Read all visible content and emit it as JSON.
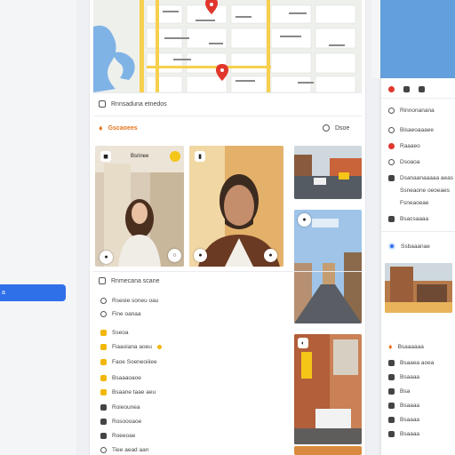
{
  "sidebar": {
    "active_label": "a"
  },
  "map": {
    "pins": [
      "red-pin",
      "red-pin"
    ],
    "colors": {
      "road": "#f6d04d",
      "water": "#7fb3e6",
      "land": "#eef0ec"
    }
  },
  "main": {
    "location_row": "Rnnsaduna etnedos",
    "section_title": "Gscaoees",
    "section_right": "Dsoe",
    "photos": {
      "woman_label": "Bsrinee",
      "man_label": "",
      "street_top_label": ""
    },
    "details_title": "Rnmecana scane",
    "details_items": [
      "Rseoie soneu oau",
      "Fine oanaa",
      "Sseoa",
      "Fiaaoiana aoeu",
      "Faoe Soeneoiiiee",
      "Bsaaaoaoe",
      "Bsaane taae aeu",
      "Roieounea",
      "Rosoooaoe",
      "Roeeoae",
      "Tiee aead aan"
    ]
  },
  "right_panel": {
    "top_icons": [
      "close-icon",
      "save-icon",
      "share-icon"
    ],
    "items": [
      "Rinnonanana",
      "Bisaeoaaaee",
      "Raaaeo",
      "Dsoaoa",
      "Dsanaanaaaaa aeas",
      "Ssneaone oeoeaes",
      "Fsneaoeae",
      "Bsacsaaaa"
    ],
    "section2_title": "Ssbaaanae",
    "section3_title": "Bsaaaaaa",
    "section3_items": [
      "Bsaaea aoea",
      "Bsaaaa",
      "Bsa",
      "Bsaaaa",
      "Bsaaaa",
      "Bsaaaa"
    ]
  }
}
